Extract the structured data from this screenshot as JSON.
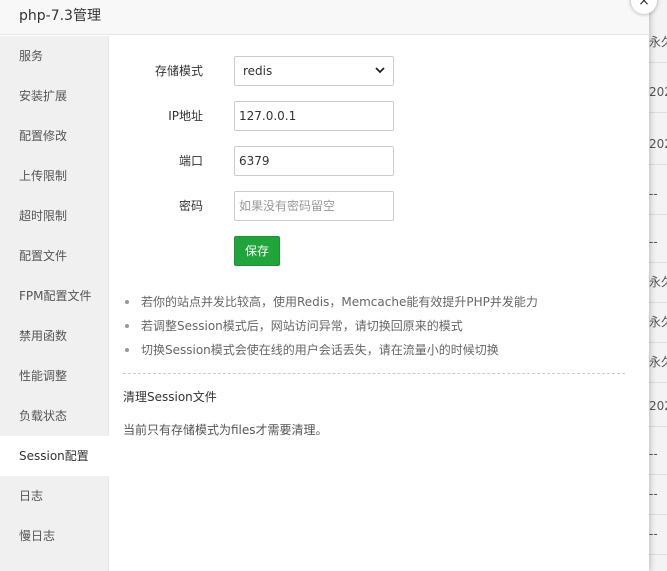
{
  "window": {
    "title": "php-7.3管理",
    "close_glyph": "×"
  },
  "sidebar": {
    "items": [
      {
        "label": "服务"
      },
      {
        "label": "安装扩展"
      },
      {
        "label": "配置修改"
      },
      {
        "label": "上传限制"
      },
      {
        "label": "超时限制"
      },
      {
        "label": "配置文件"
      },
      {
        "label": "FPM配置文件"
      },
      {
        "label": "禁用函数"
      },
      {
        "label": "性能调整"
      },
      {
        "label": "负载状态"
      },
      {
        "label": "Session配置",
        "active": true
      },
      {
        "label": "日志"
      },
      {
        "label": "慢日志"
      }
    ]
  },
  "form": {
    "storage_label": "存储模式",
    "storage_value": "redis",
    "ip_label": "IP地址",
    "ip_value": "127.0.0.1",
    "port_label": "端口",
    "port_value": "6379",
    "password_label": "密码",
    "password_value": "",
    "password_placeholder": "如果没有密码留空",
    "save_label": "保存"
  },
  "tips": [
    "若你的站点并发比较高，使用Redis，Memcache能有效提升PHP并发能力",
    "若调整Session模式后，网站访问异常，请切换回原来的模式",
    "切换Session模式会使在线的用户会话丢失，请在流量小的时候切换"
  ],
  "cleanup": {
    "title": "清理Session文件",
    "note": "当前只有存储模式为files才需要清理。"
  },
  "background_rows": [
    "永久",
    "202",
    "202",
    "--",
    "--",
    "永久",
    "永久",
    "永久",
    "202",
    "--",
    "--",
    "--"
  ],
  "colors": {
    "primary": "#20a53a",
    "sidebar_bg": "#f0f0f0"
  }
}
